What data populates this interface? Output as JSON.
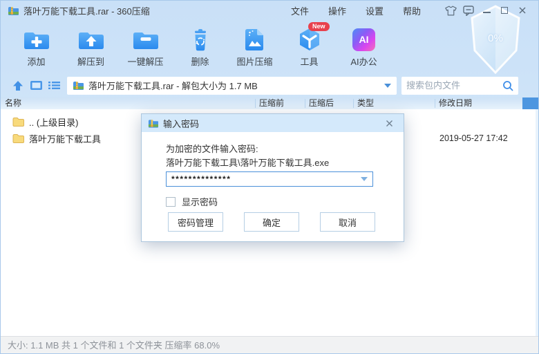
{
  "window": {
    "title": "落叶万能下载工具.rar - 360压缩",
    "menus": [
      {
        "label": "文件"
      },
      {
        "label": "操作"
      },
      {
        "label": "设置"
      },
      {
        "label": "帮助"
      }
    ]
  },
  "toolbar": {
    "items": [
      {
        "label": "添加"
      },
      {
        "label": "解压到"
      },
      {
        "label": "一键解压"
      },
      {
        "label": "删除"
      },
      {
        "label": "图片压缩"
      },
      {
        "label": "工具",
        "badge": "New"
      },
      {
        "label": "AI办公",
        "icon_text": "AI"
      }
    ],
    "shield_text": "0%"
  },
  "addressbar": {
    "archive_title": "落叶万能下载工具.rar - 解包大小为 1.7 MB",
    "search_placeholder": "搜索包内文件"
  },
  "filelist": {
    "columns": [
      {
        "label": "名称"
      },
      {
        "label": "压缩前"
      },
      {
        "label": "压缩后"
      },
      {
        "label": "类型"
      },
      {
        "label": "修改日期"
      }
    ],
    "rows": [
      {
        "name": ".. (上级目录)",
        "modified": ""
      },
      {
        "name": "落叶万能下载工具",
        "modified": "2019-05-27 17:42"
      }
    ]
  },
  "dialog": {
    "title": "输入密码",
    "prompt": "为加密的文件输入密码:",
    "file_path": "落叶万能下载工具\\落叶万能下载工具.exe",
    "password_masked": "**************",
    "show_password_label": "显示密码",
    "manage_button": "密码管理",
    "ok_button": "确定",
    "cancel_button": "取消"
  },
  "statusbar": {
    "text": "大小: 1.1 MB 共 1 个文件和 1 个文件夹 压缩率 68.0%"
  },
  "colors": {
    "accent": "#2e8bee",
    "badge_red": "#e8414d",
    "folder_yellow": "#f8da7c"
  }
}
